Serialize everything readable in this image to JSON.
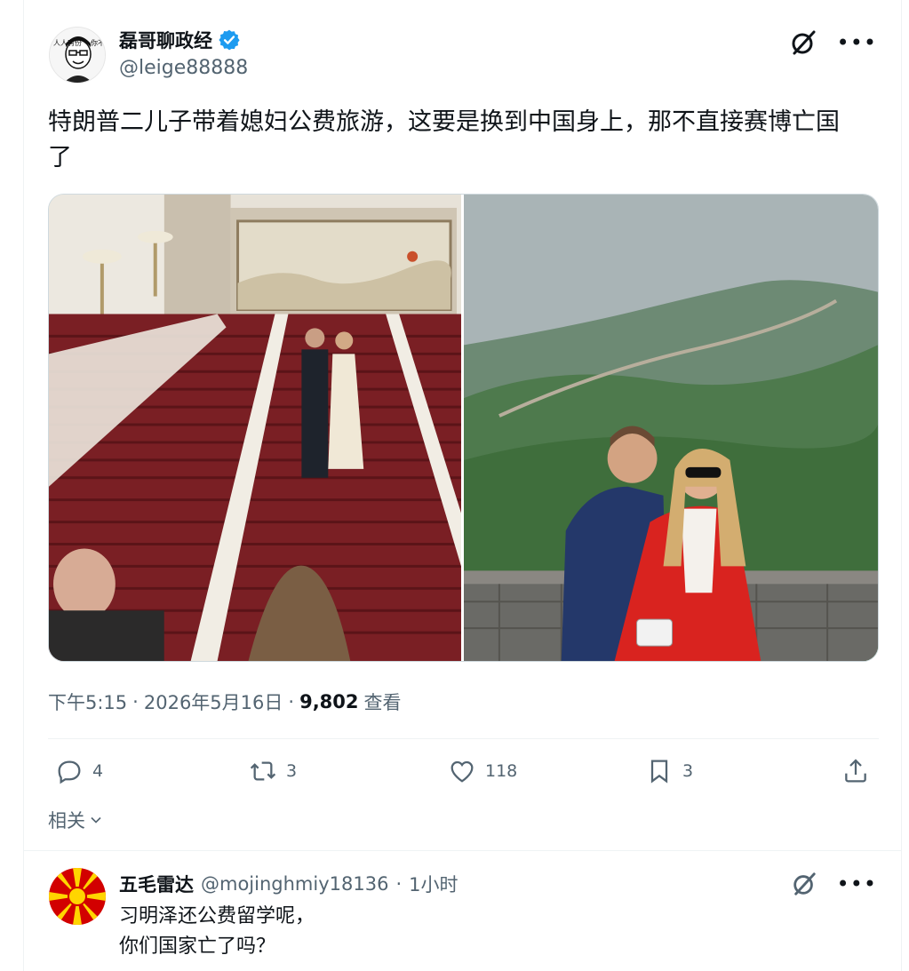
{
  "tweet": {
    "author": {
      "display_name": "磊哥聊政经",
      "handle": "@leige88888",
      "verified": true,
      "avatar_text": [
        "人人有份",
        "你不平等"
      ]
    },
    "text_line1": "特朗普二儿子带着媳妇公费旅游，这要是换到中国身上，那不直接赛博亡国",
    "text_line2": "了",
    "meta": {
      "time": "下午5:15",
      "sep1": "·",
      "date": "2026年5月16日",
      "sep2": "·",
      "views_count": "9,802",
      "views_label": "查看"
    },
    "actions": {
      "replies": "4",
      "retweets": "3",
      "likes": "118",
      "bookmarks": "3"
    },
    "media": [
      {
        "icon": "photo-hall-staircase"
      },
      {
        "icon": "photo-great-wall"
      }
    ]
  },
  "related": {
    "label": "相关"
  },
  "reply": {
    "author": {
      "display_name": "五毛雷达",
      "handle": "@mojinghmiy18136",
      "sep": "·",
      "time": "1小时"
    },
    "text_line1": "习明泽还公费留学呢，",
    "text_line2": "你们国家亡了吗？"
  },
  "colors": {
    "text": "#0f1419",
    "secondary": "#536471",
    "verified": "#1d9bf0",
    "border": "#eff3f4"
  },
  "icons": {
    "grok": "grok-icon",
    "more": "more-icon",
    "reply": "reply-icon",
    "retweet": "retweet-icon",
    "like": "heart-icon",
    "bookmark": "bookmark-icon",
    "share": "share-icon",
    "chevron": "chevron-down-icon"
  }
}
